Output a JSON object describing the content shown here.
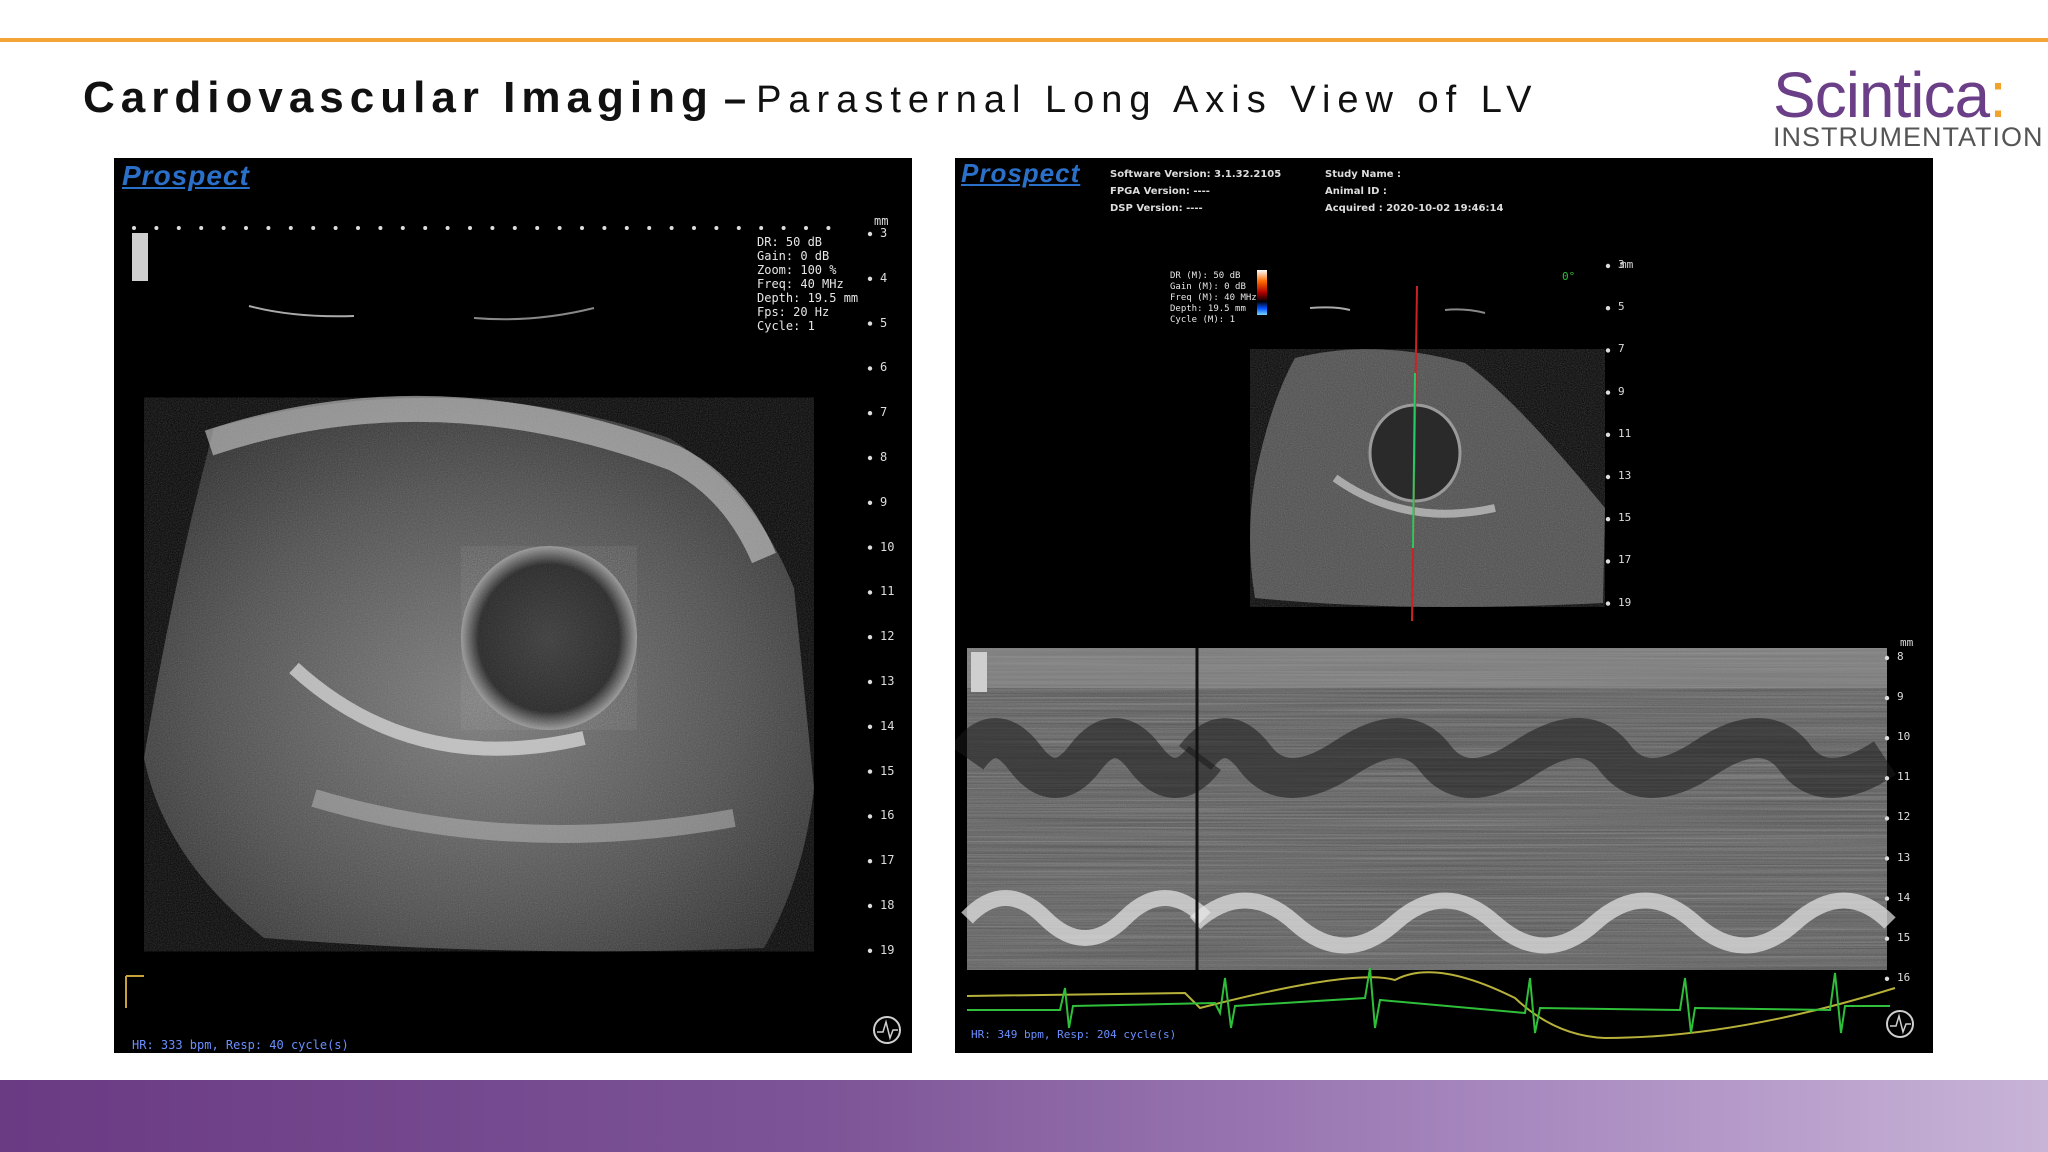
{
  "header": {
    "title_main": "Cardiovascular Imaging",
    "title_dash": "–",
    "title_sub": "Parasternal Long Axis View of LV"
  },
  "logo": {
    "name": "Scintica",
    "colon": ":",
    "tagline": "INSTRUMENTATION"
  },
  "colors": {
    "accent_orange": "#f4a435",
    "brand_purple": "#6b3f87"
  },
  "left_image": {
    "brand": "Prospect",
    "unit": "mm",
    "readout": [
      "DR: 50 dB",
      "Gain: 0 dB",
      "Zoom: 100 %",
      "Freq: 40 MHz",
      "Depth: 19.5 mm",
      "Fps: 20 Hz",
      "Cycle: 1"
    ],
    "depth_ticks": [
      "3",
      "4",
      "5",
      "6",
      "7",
      "8",
      "9",
      "10",
      "11",
      "12",
      "13",
      "14",
      "15",
      "16",
      "17",
      "18",
      "19"
    ],
    "status": "HR: 333 bpm, Resp: 40 cycle(s)"
  },
  "right_image": {
    "brand": "Prospect",
    "meta_left": [
      "Software Version: 3.1.32.2105",
      "FPGA Version: ----",
      "DSP Version: ----"
    ],
    "meta_right": [
      "Study Name :",
      "Animal ID :",
      "Acquired : 2020-10-02 19:46:14"
    ],
    "readout": [
      "DR (M): 50 dB",
      "Gain (M): 0 dB",
      "Freq (M): 40 MHz",
      "Depth: 19.5 mm",
      "Cycle (M): 1"
    ],
    "angle": "0°",
    "unit_top": "mm",
    "ticks_top": [
      "3",
      "5",
      "7",
      "9",
      "11",
      "13",
      "15",
      "17",
      "19"
    ],
    "unit_mmode": "mm",
    "ticks_mmode": [
      "8",
      "9",
      "10",
      "11",
      "12",
      "13",
      "14",
      "15",
      "16"
    ],
    "status": "HR: 349 bpm, Resp: 204 cycle(s)"
  }
}
